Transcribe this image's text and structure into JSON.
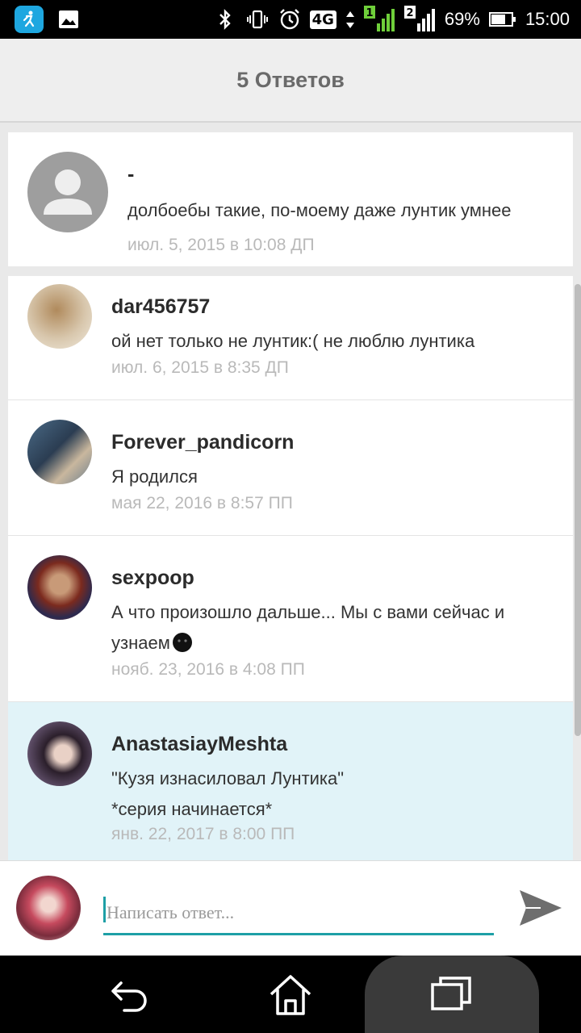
{
  "status_bar": {
    "network_label": "4G",
    "sim1_label": "1",
    "sim2_label": "2",
    "battery": "69%",
    "time": "15:00",
    "icons": [
      "fitness-app-icon",
      "gallery-icon",
      "bluetooth-icon",
      "vibrate-icon",
      "alarm-icon",
      "signal-icon",
      "battery-icon"
    ]
  },
  "header": {
    "title": "5 Ответов"
  },
  "root_comment": {
    "user": "-",
    "text": "долбоебы такие, по-моему даже лунтик умнее",
    "date": "июл. 5, 2015 в 10:08 ДП"
  },
  "replies": [
    {
      "user": "dar456757",
      "text": "ой нет только не лунтик:( не люблю лунтика",
      "date": "июл. 6, 2015 в 8:35 ДП"
    },
    {
      "user": "Forever_pandicorn",
      "text": "Я родился",
      "date": "мая 22, 2016 в 8:57 ПП"
    },
    {
      "user": "sexpoop",
      "text_line1": "А что произошло дальше... Мы с вами сейчас и",
      "text_line2": "узнаем",
      "date": "нояб. 23, 2016 в 4:08 ПП"
    },
    {
      "user": "AnastasiayMeshta",
      "text_line1": "\"Кузя изнасиловал Лунтика\"",
      "text_line2": "*серия начинается*",
      "date": "янв. 22, 2017 в 8:00 ПП"
    }
  ],
  "reply_input": {
    "placeholder": "Написать ответ..."
  },
  "colors": {
    "accent": "#1e9fa6",
    "highlight_bg": "#e1f3f8",
    "date_gray": "#b9b9b9"
  }
}
